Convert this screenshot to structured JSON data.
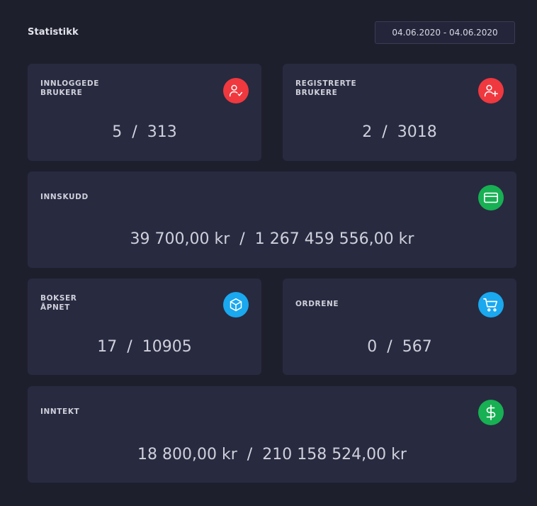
{
  "page": {
    "title": "Statistikk",
    "date_range": "04.06.2020 - 04.06.2020"
  },
  "cards": {
    "logged_in": {
      "label": "INNLOGGEDE\nBRUKERE",
      "current": "5",
      "total": "313",
      "icon": "user-check-icon",
      "icon_color": "#f0383f"
    },
    "registered": {
      "label": "REGISTRERTE\nBRUKERE",
      "current": "2",
      "total": "3018",
      "icon": "user-plus-icon",
      "icon_color": "#f0383f"
    },
    "deposits": {
      "label": "INNSKUDD",
      "current": "39 700,00 kr",
      "total": "1 267 459 556,00 kr",
      "icon": "credit-card-icon",
      "icon_color": "#17b053"
    },
    "boxes_opened": {
      "label": "BOKSER\nÅPNET",
      "current": "17",
      "total": "10905",
      "icon": "box-icon",
      "icon_color": "#1aa8ef"
    },
    "orders": {
      "label": "ORDRENE",
      "current": "0",
      "total": "567",
      "icon": "shopping-cart-icon",
      "icon_color": "#1aa8ef"
    },
    "revenue": {
      "label": "INNTEKT",
      "current": "18 800,00 kr",
      "total": "210 158 524,00 kr",
      "icon": "dollar-icon",
      "icon_color": "#17b053"
    }
  },
  "separator": "/"
}
